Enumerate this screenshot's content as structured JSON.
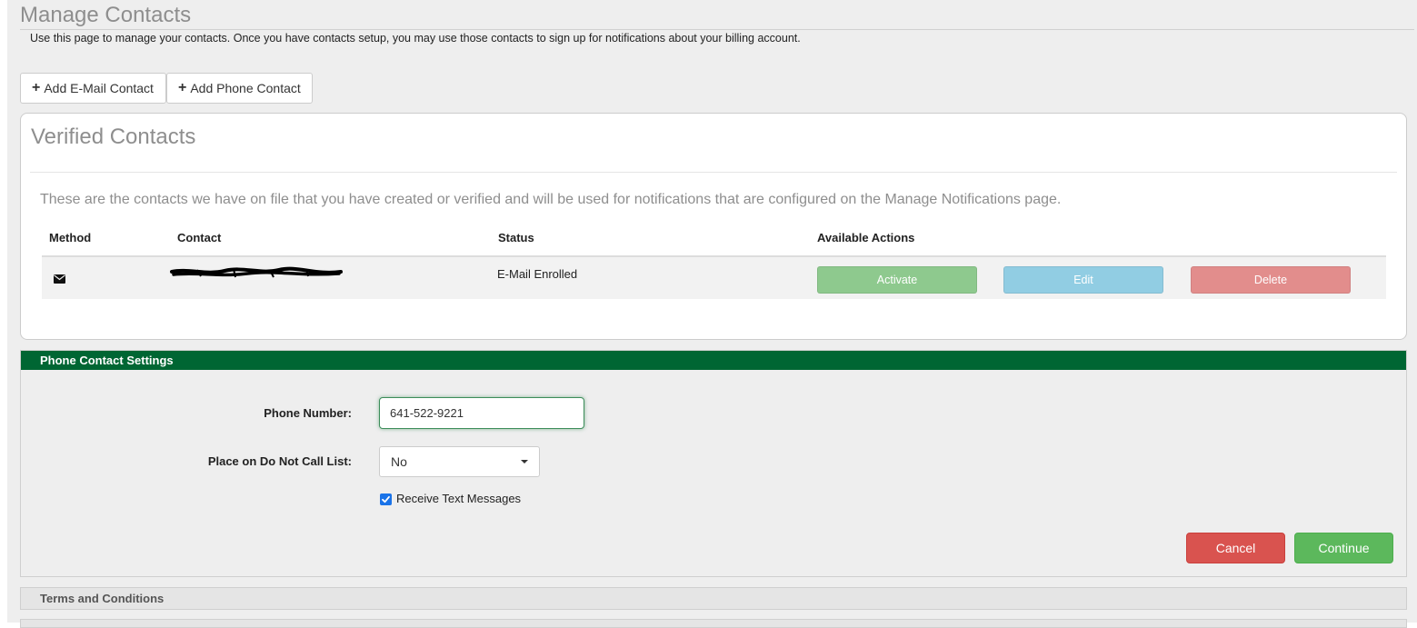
{
  "header": {
    "title": "Manage Contacts",
    "intro": "Use this page to manage your contacts. Once you have contacts setup, you may use those contacts to sign up for notifications about your billing account."
  },
  "toolbar": {
    "add_email_label": "Add E-Mail Contact",
    "add_phone_label": "Add Phone Contact"
  },
  "verified": {
    "title": "Verified Contacts",
    "description": "These are the contacts we have on file that you have created or verified and will be used for notifications that are configured on the Manage Notifications page.",
    "columns": [
      "Method",
      "Contact",
      "Status",
      "Available Actions"
    ],
    "rows": [
      {
        "method_icon": "envelope-icon",
        "status": "E-Mail Enrolled",
        "actions": [
          "Activate",
          "Edit",
          "Delete"
        ]
      }
    ]
  },
  "phone_settings": {
    "title": "Phone Contact Settings",
    "phone_label": "Phone Number:",
    "phone_value": "641-522-9221",
    "dnc_label": "Place on Do Not Call List:",
    "dnc_value": "No",
    "text_label": "Receive Text Messages",
    "text_checked": true,
    "cancel_label": "Cancel",
    "continue_label": "Continue"
  },
  "terms": {
    "title": "Terms and Conditions"
  },
  "colors": {
    "header_green": "#006633",
    "activate": "#8ec98e",
    "edit": "#91cde3",
    "delete": "#e28d8c",
    "cancel": "#d9534f",
    "continue": "#5cb85c"
  }
}
